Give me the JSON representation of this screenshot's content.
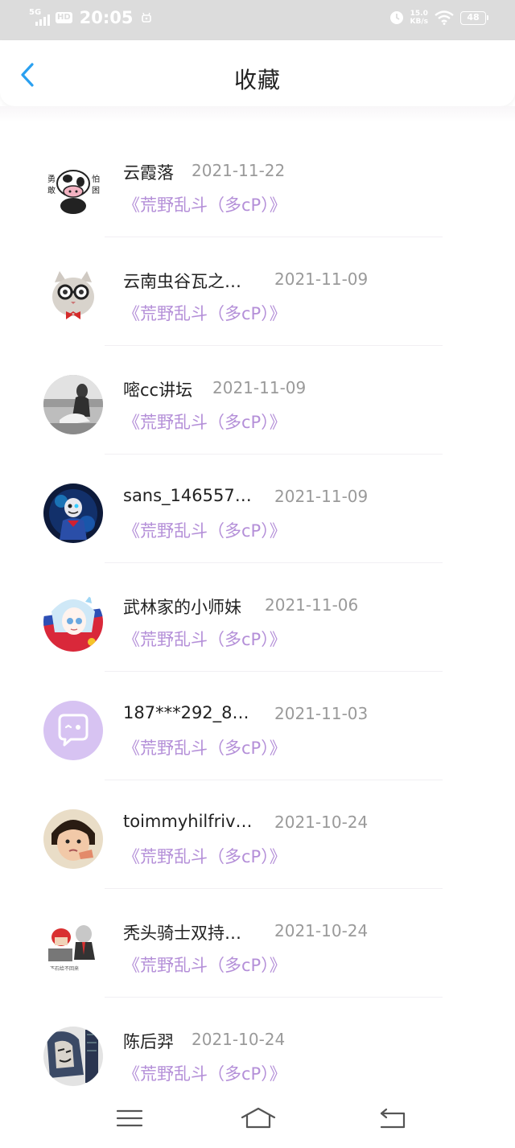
{
  "status_bar": {
    "network": "5G",
    "hd": "HD",
    "time": "20:05",
    "speed_value": "15.0",
    "speed_unit": "KB/s",
    "battery": "48"
  },
  "header": {
    "title": "收藏"
  },
  "items": [
    {
      "name": "云霞落",
      "date": "2021-11-22",
      "work": "《荒野乱斗（多cP）》",
      "avatar": "cow-comic-avatar"
    },
    {
      "name": "云南虫谷瓦之…",
      "date": "2021-11-09",
      "work": "《荒野乱斗（多cP）》",
      "avatar": "cat-with-glasses-avatar"
    },
    {
      "name": "嘧cc讲坛",
      "date": "2021-11-09",
      "work": "《荒野乱斗（多cP）》",
      "avatar": "bw-photo-avatar"
    },
    {
      "name": "sans_146557…",
      "date": "2021-11-09",
      "work": "《荒野乱斗（多cP）》",
      "avatar": "game-character-avatar"
    },
    {
      "name": "武林家的小师妹",
      "date": "2021-11-06",
      "work": "《荒野乱斗（多cP）》",
      "avatar": "anime-girl-avatar"
    },
    {
      "name": "187***292_8…",
      "date": "2021-11-03",
      "work": "《荒野乱斗（多cP）》",
      "avatar": "default-chat-avatar"
    },
    {
      "name": "toimmyhilfriv…",
      "date": "2021-10-24",
      "work": "《荒野乱斗（多cP）》",
      "avatar": "child-photo-avatar"
    },
    {
      "name": "秃头骑士双持…",
      "date": "2021-10-24",
      "work": "《荒野乱斗（多cP）》",
      "avatar": "meme-cartoon-avatar"
    },
    {
      "name": "陈后羿",
      "date": "2021-10-24",
      "work": "《荒野乱斗（多cP）》",
      "avatar": "ink-drawing-avatar"
    }
  ],
  "navbar": {
    "menu_icon": "menu-icon",
    "home_icon": "home-icon",
    "back_icon": "return-icon"
  },
  "colors": {
    "accent_blue": "#2aa0f0",
    "work_purple": "#b48fd8",
    "date_gray": "#9a9a9a",
    "default_avatar": "#d7c3f2"
  }
}
